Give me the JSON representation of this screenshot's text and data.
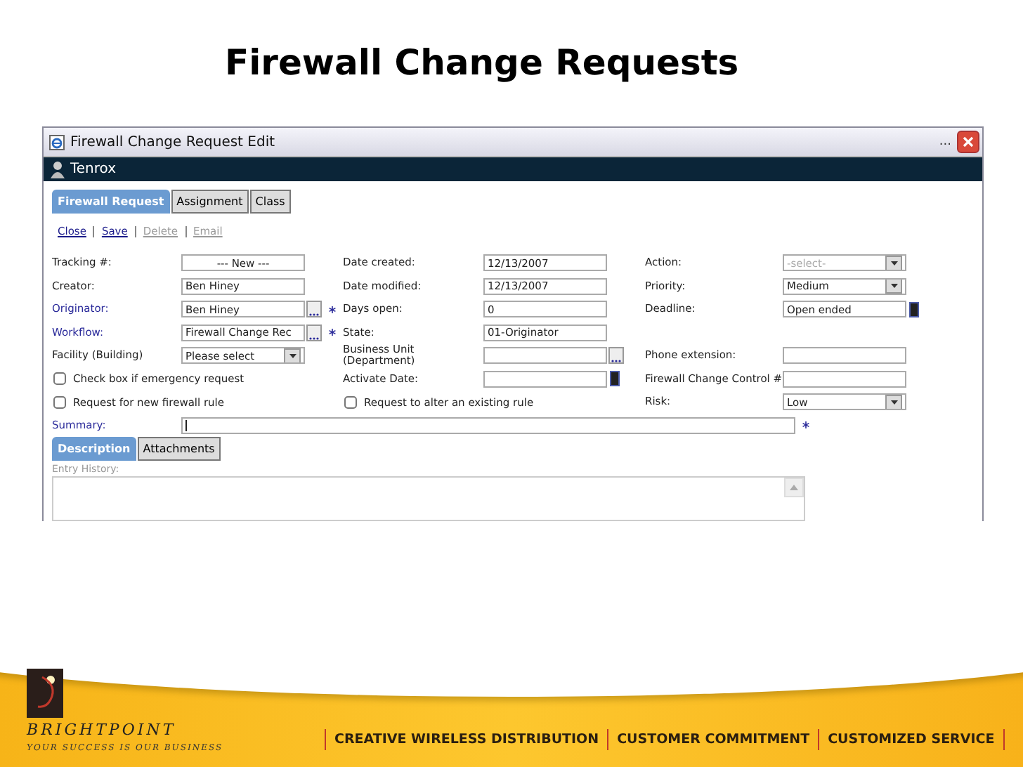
{
  "slide_title": "Firewall Change Requests",
  "window": {
    "title": "Firewall Change Request Edit",
    "menu": "...",
    "brand": "Tenrox"
  },
  "tabs": [
    {
      "label": "Firewall Request",
      "selected": true
    },
    {
      "label": "Assignment",
      "selected": false
    },
    {
      "label": "Class",
      "selected": false
    }
  ],
  "actions": [
    {
      "label": "Close",
      "disabled": false
    },
    {
      "label": "Save",
      "disabled": false
    },
    {
      "label": "Delete",
      "disabled": true
    },
    {
      "label": "Email",
      "disabled": true
    }
  ],
  "rows": [
    [
      {
        "label": "Tracking #:",
        "kind": "text",
        "value": "--- New ---",
        "centered": true
      },
      {
        "label": "Date created:",
        "kind": "text",
        "value": "12/13/2007"
      },
      {
        "label": "Action:",
        "kind": "select",
        "placeholder": "-select-"
      }
    ],
    [
      {
        "label": "Creator:",
        "kind": "text",
        "value": "Ben Hiney"
      },
      {
        "label": "Date modified:",
        "kind": "text",
        "value": "12/13/2007"
      },
      {
        "label": "Priority:",
        "kind": "select",
        "value": "Medium"
      }
    ],
    [
      {
        "label": "Originator:",
        "kind": "lookup",
        "value": "Ben Hiney",
        "linked": true,
        "required": true
      },
      {
        "label": "Days open:",
        "kind": "text",
        "value": "0"
      },
      {
        "label": "Deadline:",
        "kind": "date",
        "value": "Open ended"
      }
    ],
    [
      {
        "label": "Workflow:",
        "kind": "lookup",
        "value": "Firewall Change Rec",
        "linked": true,
        "required": true
      },
      {
        "label": "State:",
        "kind": "text",
        "value": "01-Originator"
      },
      {
        "kind": "empty"
      }
    ],
    [
      {
        "label": "Facility (Building)",
        "kind": "select",
        "value": "Please select"
      },
      {
        "label": "Business Unit (Department)",
        "kind": "lookup"
      },
      {
        "label": "Phone extension:",
        "kind": "text"
      }
    ],
    [
      {
        "label": "Check box if emergency request",
        "kind": "checkbox",
        "checked": false
      },
      {
        "label": "Activate Date:",
        "kind": "date"
      },
      {
        "label": "Firewall Change Control #",
        "kind": "text"
      }
    ],
    [
      {
        "label": "Request for new firewall rule",
        "kind": "checkbox",
        "checked": false
      },
      {
        "label": "Request to alter an existing rule",
        "kind": "checkbox",
        "checked": false
      },
      {
        "label": "Risk:",
        "kind": "select",
        "value": "Low"
      }
    ]
  ],
  "summary": {
    "label": "Summary:",
    "required": true
  },
  "lower_tabs": [
    {
      "label": "Description",
      "selected": true
    },
    {
      "label": "Attachments",
      "selected": false
    }
  ],
  "entry_history": {
    "label": "Entry History:"
  },
  "footer": {
    "brand": "BRIGHTPOINT",
    "tagline": "YOUR SUCCESS IS OUR BUSINESS",
    "slogans": [
      "CREATIVE WIRELESS DISTRIBUTION",
      "CUSTOMER COMMITMENT",
      "CUSTOMIZED SERVICE"
    ]
  }
}
